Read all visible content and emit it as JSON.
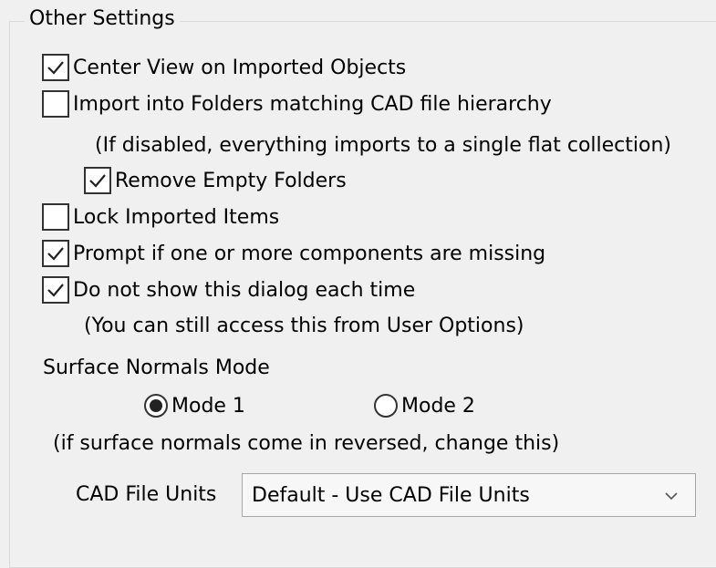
{
  "group": {
    "title": "Other Settings"
  },
  "checkboxes": [
    {
      "label": "Center View on Imported Objects",
      "checked": true
    },
    {
      "label": "Import into Folders matching CAD file hierarchy",
      "checked": false
    },
    {
      "label": "Remove Empty Folders",
      "checked": true
    },
    {
      "label": "Lock Imported Items",
      "checked": false
    },
    {
      "label": "Prompt if one or more components are missing",
      "checked": true
    },
    {
      "label": "Do not show this dialog each time",
      "checked": true
    }
  ],
  "notes": {
    "folders_note": "(If disabled, everything imports to a single flat collection)",
    "user_options_note": "(You can still access this from User Options)",
    "normals_note": "(if surface normals come in reversed, change this)"
  },
  "surface_normals": {
    "heading": "Surface Normals Mode",
    "options": [
      {
        "label": "Mode 1",
        "selected": true
      },
      {
        "label": "Mode 2",
        "selected": false
      }
    ]
  },
  "cad_units": {
    "label": "CAD File Units",
    "selected_value": "Default - Use CAD File Units"
  },
  "icons": {
    "check": "checkmark-icon",
    "dropdown": "chevron-down-icon"
  }
}
